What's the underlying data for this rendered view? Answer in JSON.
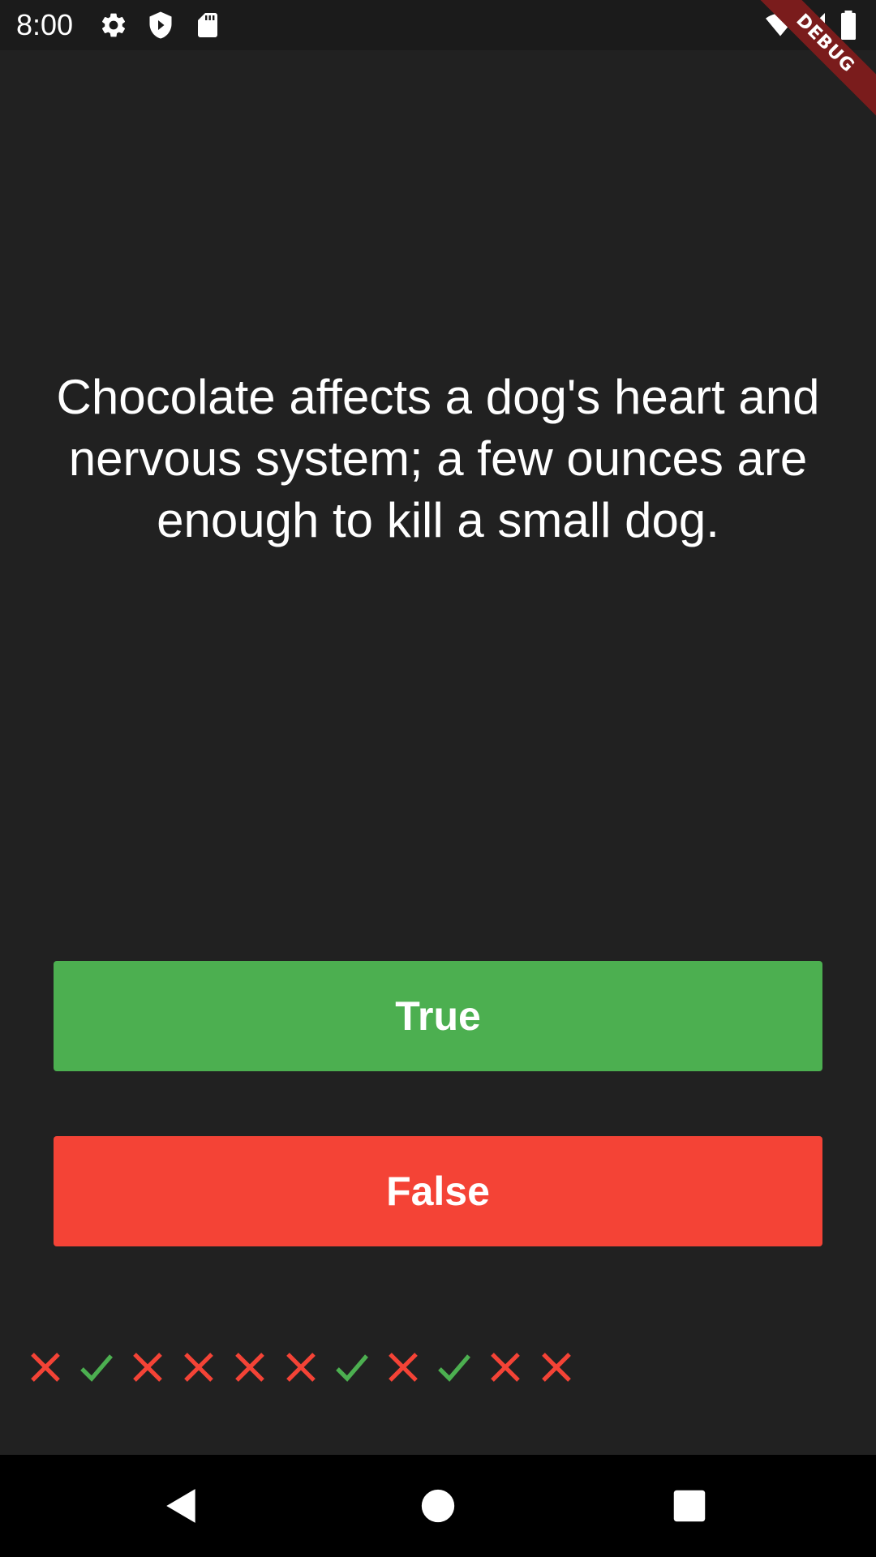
{
  "status_bar": {
    "time": "8:00",
    "icons": [
      "gear-icon",
      "shield-icon",
      "sd-card-icon",
      "wifi-icon",
      "signal-icon",
      "battery-icon"
    ]
  },
  "debug_banner": {
    "label": "DEBUG"
  },
  "quiz": {
    "question": "Chocolate affects a dog's heart and nervous system; a few ounces are enough to kill a small dog.",
    "true_label": "True",
    "false_label": "False",
    "score_marks": [
      "wrong",
      "correct",
      "wrong",
      "wrong",
      "wrong",
      "wrong",
      "correct",
      "wrong",
      "correct",
      "wrong",
      "wrong"
    ]
  },
  "colors": {
    "background": "#212121",
    "true_button": "#4caf50",
    "false_button": "#f44336",
    "correct_mark": "#4caf50",
    "wrong_mark": "#f44336"
  },
  "nav_bar": {
    "icons": [
      "back-icon",
      "home-icon",
      "recents-icon"
    ]
  }
}
